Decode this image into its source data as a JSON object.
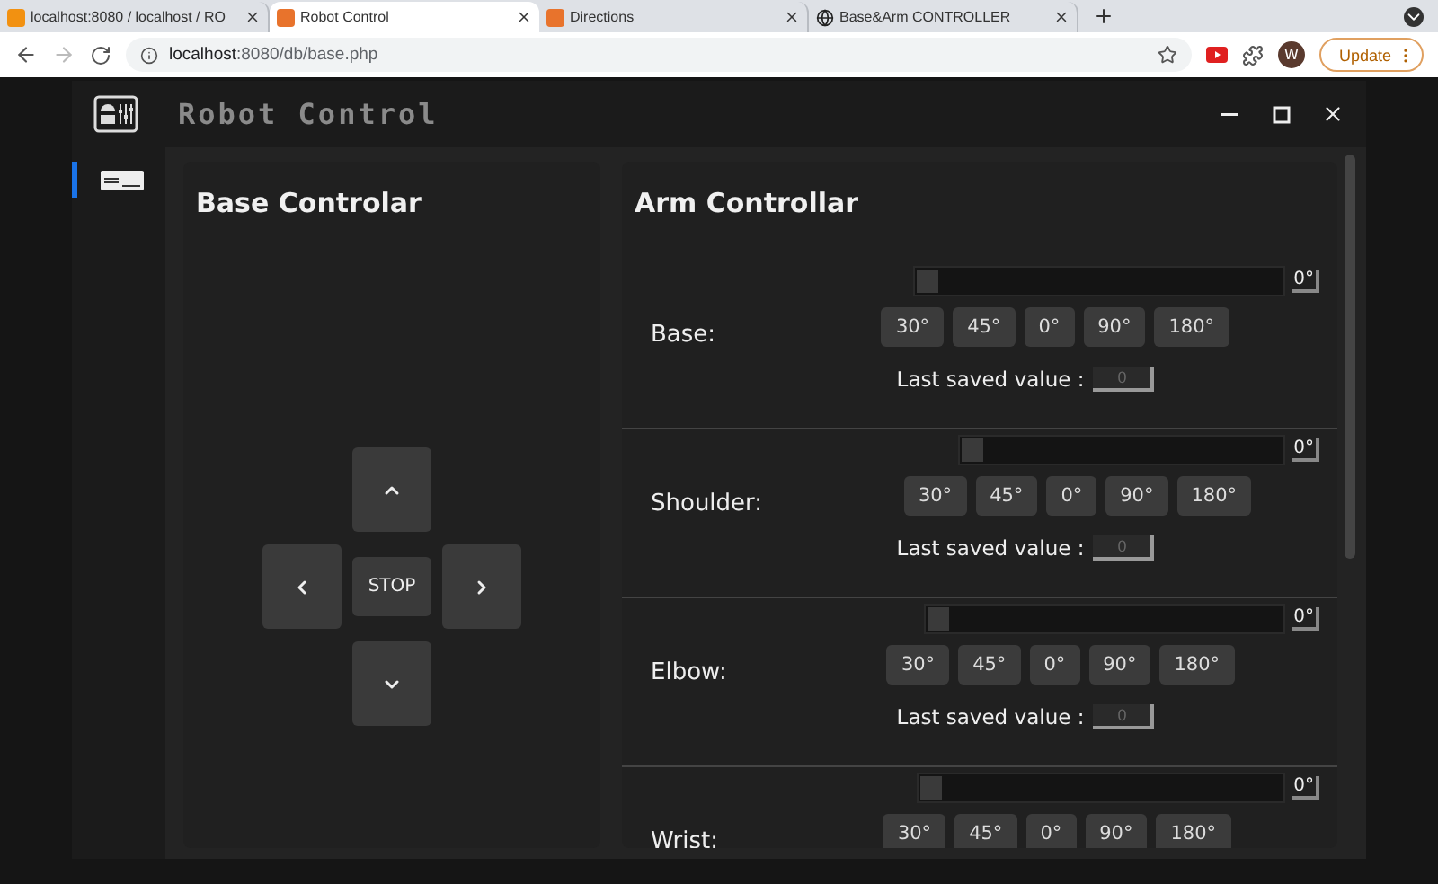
{
  "browser": {
    "tabs": [
      {
        "title": "localhost:8080 / localhost / RO",
        "selected": false,
        "kind": "pma"
      },
      {
        "title": "Robot Control",
        "selected": true,
        "kind": "xampp"
      },
      {
        "title": "Directions",
        "selected": false,
        "kind": "xampp"
      },
      {
        "title": "Base&Arm CONTROLLER",
        "selected": false,
        "kind": "globe"
      }
    ],
    "url_host": "localhost",
    "url_rest": ":8080/db/base.php",
    "avatar": "W",
    "update_label": "Update"
  },
  "app": {
    "title": "Robot Control",
    "sidebar": {
      "items": [
        {
          "selected": true
        }
      ]
    },
    "base_panel": {
      "title": "Base Controlar",
      "buttons": [
        {
          "kind": "up"
        },
        {
          "kind": "left"
        },
        {
          "kind": "stop",
          "label": "STOP"
        },
        {
          "kind": "right"
        },
        {
          "kind": "down"
        }
      ]
    },
    "arm_panel": {
      "title": "Arm Controllar",
      "joints": [
        {
          "name": "Base:",
          "level": 0,
          "value": "0°",
          "presets": [
            "30°",
            "45°",
            "0°",
            "90°",
            "180°"
          ],
          "saved_label": "Last saved value :",
          "saved_value": "0"
        },
        {
          "name": "Shoulder:",
          "level": 0,
          "value": "0°",
          "presets": [
            "30°",
            "45°",
            "0°",
            "90°",
            "180°"
          ],
          "saved_label": "Last saved value :",
          "saved_value": "0"
        },
        {
          "name": "Elbow:",
          "level": 0,
          "value": "0°",
          "presets": [
            "30°",
            "45°",
            "0°",
            "90°",
            "180°"
          ],
          "saved_label": "Last saved value :",
          "saved_value": "0"
        },
        {
          "name": "Wrist:",
          "level": 0,
          "value": "0°",
          "presets": [
            "30°",
            "45°",
            "0°",
            "90°",
            "180°"
          ]
        }
      ]
    }
  }
}
